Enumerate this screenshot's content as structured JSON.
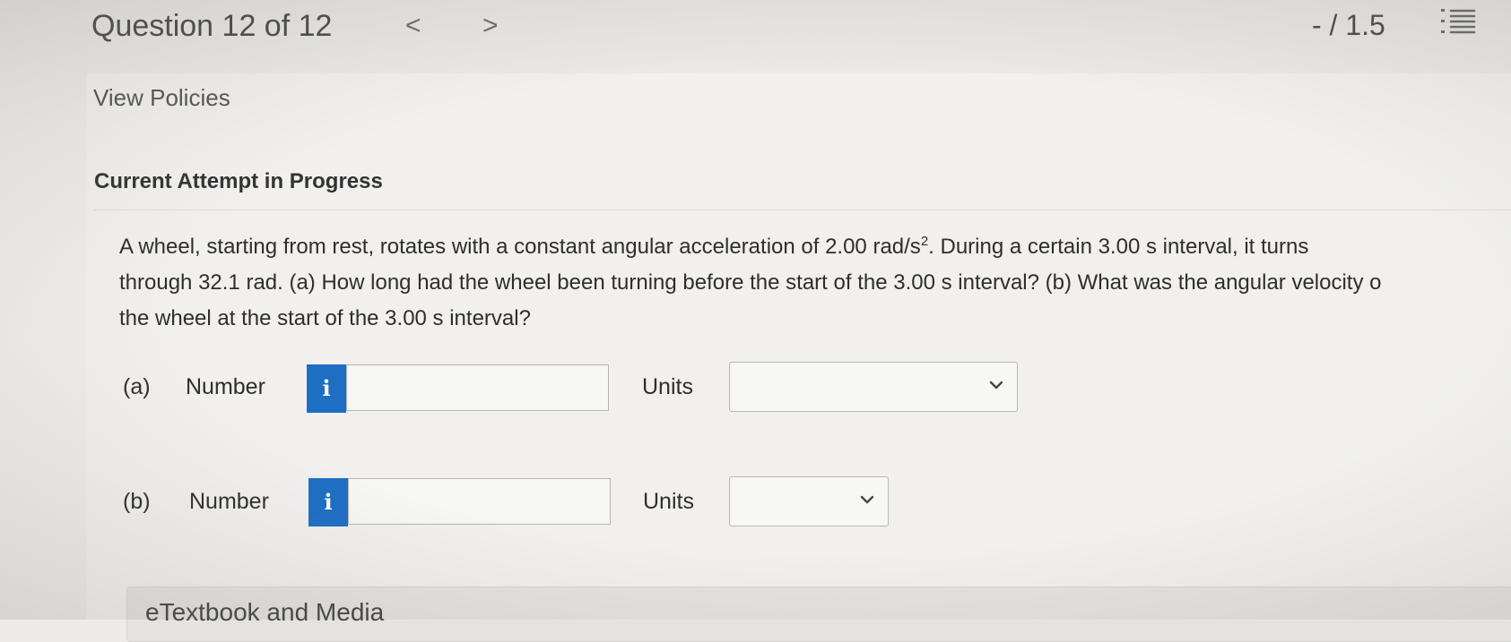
{
  "header": {
    "question_title": "Question 12 of 12",
    "prev_icon": "<",
    "next_icon": ">",
    "score": "- / 1.5",
    "list_icon": "numbered-list-icon"
  },
  "links": {
    "view_policies": "View Policies"
  },
  "attempt_heading": "Current Attempt in Progress",
  "question": {
    "line1_a": "A wheel, starting from rest, rotates with a constant angular acceleration of 2.00 rad/s",
    "line1_sup": "2",
    "line1_b": ". During a certain 3.00 s interval, it turns",
    "line2": "through 32.1 rad. (a) How long had the wheel been turning before the start of the 3.00 s interval? (b) What was the angular velocity o",
    "line3": "the wheel at the start of the 3.00 s interval?"
  },
  "parts": [
    {
      "label": "(a)",
      "number_label": "Number",
      "info_icon": "i",
      "value": "",
      "units_label": "Units",
      "units_value": ""
    },
    {
      "label": "(b)",
      "number_label": "Number",
      "info_icon": "i",
      "value": "",
      "units_label": "Units",
      "units_value": ""
    }
  ],
  "etextbook": {
    "label": "eTextbook and Media"
  },
  "colors": {
    "info_button": "#1e6ec4",
    "background": "#ecebe9"
  }
}
